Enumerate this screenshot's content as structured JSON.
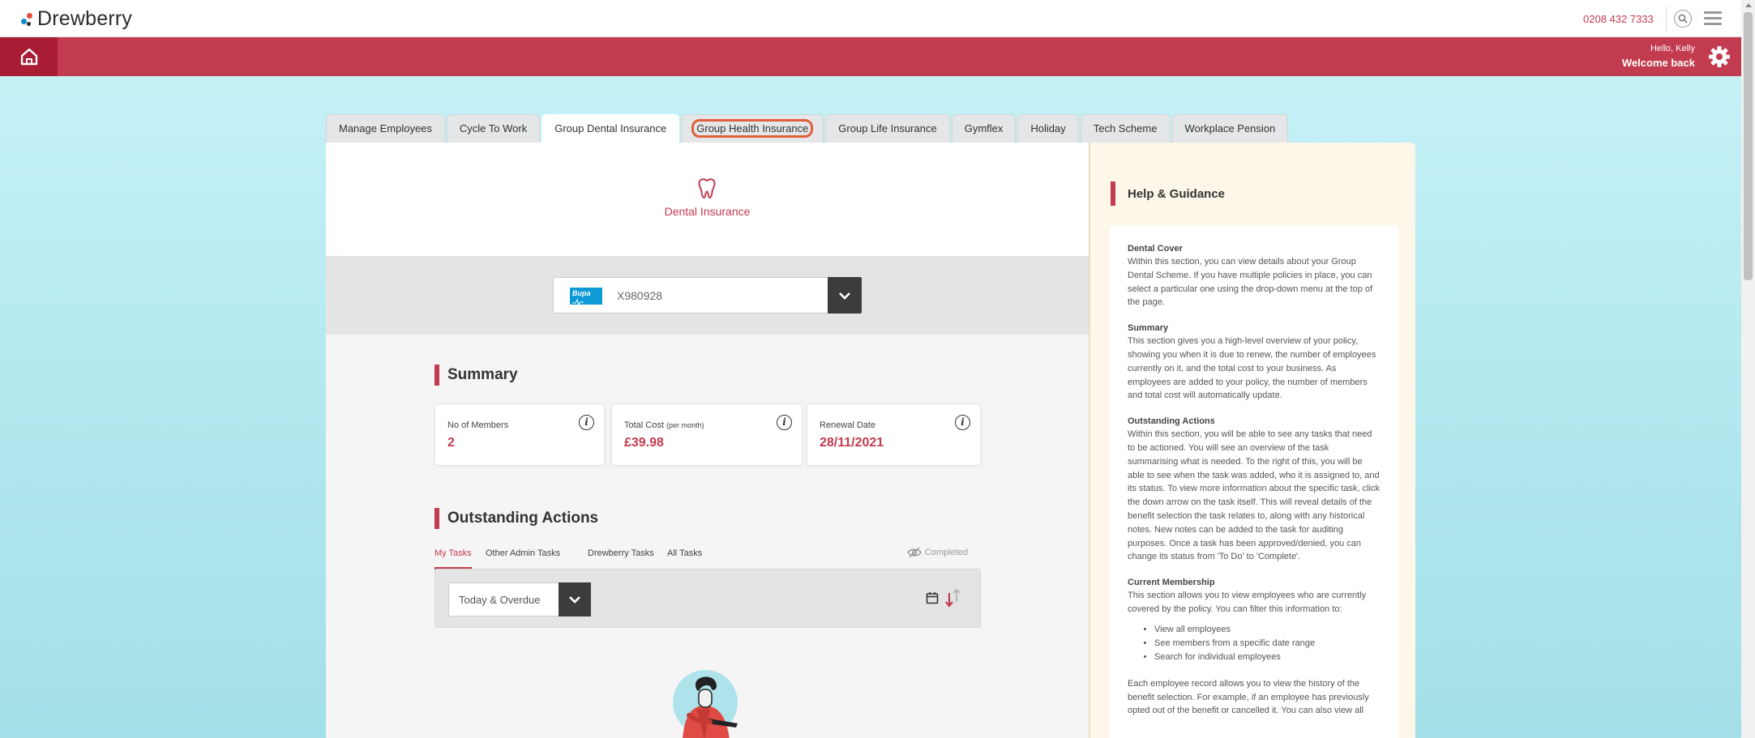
{
  "header": {
    "brand": "Drewberry",
    "phone": "0208 432 7333"
  },
  "redbar": {
    "greeting": "Hello, Kelly",
    "welcome": "Welcome back"
  },
  "tabs": [
    {
      "label": "Manage Employees"
    },
    {
      "label": "Cycle To Work"
    },
    {
      "label": "Group Dental Insurance"
    },
    {
      "label": "Group Health Insurance"
    },
    {
      "label": "Group Life Insurance"
    },
    {
      "label": "Gymflex"
    },
    {
      "label": "Holiday"
    },
    {
      "label": "Tech Scheme"
    },
    {
      "label": "Workplace Pension"
    }
  ],
  "hero": {
    "title": "Dental Insurance",
    "icon": "tooth-icon"
  },
  "policy_select": {
    "logo_text": "Bupa",
    "value": "X980928"
  },
  "summary": {
    "heading": "Summary",
    "cards": [
      {
        "label": "No of Members",
        "sublabel": "",
        "value": "2"
      },
      {
        "label": "Total Cost",
        "sublabel": "(per month)",
        "value": "£39.98"
      },
      {
        "label": "Renewal Date",
        "sublabel": "",
        "value": "28/11/2021"
      }
    ],
    "info_glyph": "i"
  },
  "outstanding": {
    "heading": "Outstanding Actions",
    "subtabs": [
      "My Tasks",
      "Other Admin Tasks",
      "Drewberry Tasks",
      "All Tasks"
    ],
    "completed_label": "Completed",
    "filter_value": "Today & Overdue"
  },
  "help": {
    "heading": "Help & Guidance",
    "sections": [
      {
        "title": "Dental Cover",
        "body": "Within this section, you can view details about your Group Dental Scheme. If you have multiple policies in place, you can select a particular one using the drop-down menu at the top of the page."
      },
      {
        "title": "Summary",
        "body": "This section gives you a high-level overview of your policy, showing you when it is due to renew, the number of employees currently on it, and the total cost to your business. As employees are added to your policy, the number of members and total cost will automatically update."
      },
      {
        "title": "Outstanding Actions",
        "body": "Within this section, you will be able to see any tasks that need to be actioned. You will see an overview of the task summarising what is needed. To the right of this, you will be able to see when the task was added, who it is assigned to, and its status. To view more information about the specific task, click the down arrow on the task itself. This will reveal details of the benefit selection the task relates to, along with any historical notes. New notes can be added to the task for auditing purposes. Once a task has been approved/denied, you can change its status from 'To Do' to 'Complete'."
      },
      {
        "title": "Current Membership",
        "body": "This section allows you to view employees who are currently covered by the policy. You can filter this information to:"
      }
    ],
    "list": [
      "View all employees",
      "See members from a specific date range",
      "Search for individual employees"
    ],
    "tail": "Each employee record allows you to view the history of the benefit selection. For example, if an employee has previously opted out of the benefit or cancelled it. You can also view all"
  },
  "colors": {
    "brand_red": "#c33b4f",
    "dark_red": "#a81d33",
    "focus_ring": "#e0603c",
    "bupa_blue": "#0e9ad7"
  }
}
